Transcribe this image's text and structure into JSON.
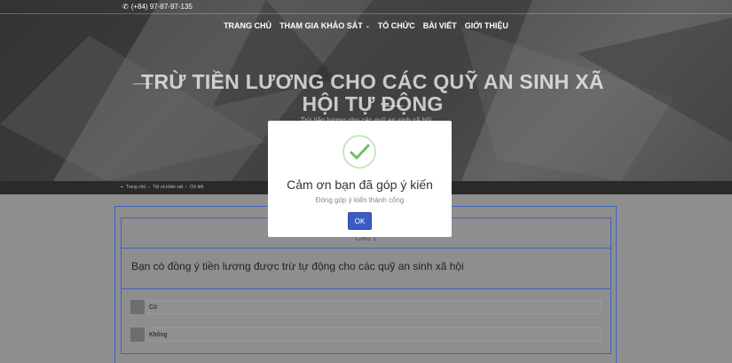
{
  "topbar": {
    "phone": "(+84) 97-87-97-135",
    "phone_icon": "phone-icon"
  },
  "nav": {
    "items": [
      {
        "label": "TRANG CHỦ"
      },
      {
        "label": "THAM GIA KHẢO SÁT",
        "has_dropdown": true
      },
      {
        "label": "TỔ CHỨC"
      },
      {
        "label": "BÀI VIẾT"
      },
      {
        "label": "GIỚI THIỆU"
      }
    ]
  },
  "hero": {
    "title": "TRỪ TIỀN LƯƠNG CHO CÁC QUỸ AN SINH XÃ HỘI TỰ ĐỘNG",
    "subtitle": "Trừ tiền lương cho các quỹ an sinh xã hội"
  },
  "breadcrumb": {
    "items": [
      "Trang chủ",
      "Tất cả khảo sát",
      "Chi tiết"
    ]
  },
  "survey": {
    "question_number": "CÂU 1",
    "question": "Bạn có đồng ý tiền lương được trừ tự động cho các quỹ an sinh xã hội",
    "options": [
      "Có",
      "Không"
    ]
  },
  "modal": {
    "title": "Cảm ơn bạn đã góp ý kiến",
    "message": "Đóng góp ý kiến thành công",
    "ok_label": "OK",
    "icon": "check-icon",
    "accent": "#3b5bc3",
    "success_color": "#5cb85c"
  }
}
